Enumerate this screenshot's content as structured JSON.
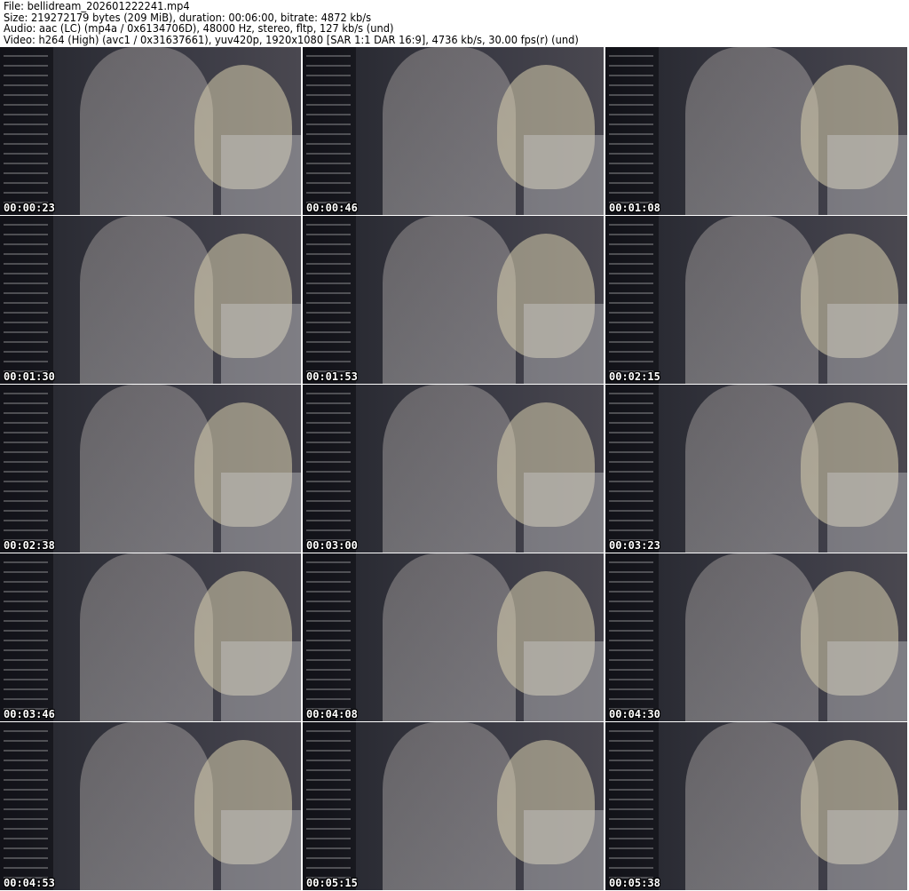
{
  "header": {
    "file": "File: bellidream_202601222241.mp4",
    "size": "Size: 219272179 bytes (209 MiB), duration: 00:06:00, bitrate: 4872 kb/s",
    "audio": "Audio: aac (LC) (mp4a / 0x6134706D), 48000 Hz, stereo, fltp, 127 kb/s (und)",
    "video": "Video: h264 (High) (avc1 / 0x31637661), yuv420p, 1920x1080 [SAR 1:1 DAR 16:9], 4736 kb/s, 30.00 fps(r) (und)"
  },
  "frames": [
    {
      "timestamp": "00:00:23"
    },
    {
      "timestamp": "00:00:46"
    },
    {
      "timestamp": "00:01:08"
    },
    {
      "timestamp": "00:01:30"
    },
    {
      "timestamp": "00:01:53"
    },
    {
      "timestamp": "00:02:15"
    },
    {
      "timestamp": "00:02:38"
    },
    {
      "timestamp": "00:03:00"
    },
    {
      "timestamp": "00:03:23"
    },
    {
      "timestamp": "00:03:46"
    },
    {
      "timestamp": "00:04:08"
    },
    {
      "timestamp": "00:04:30"
    },
    {
      "timestamp": "00:04:53"
    },
    {
      "timestamp": "00:05:15"
    },
    {
      "timestamp": "00:05:38"
    }
  ]
}
